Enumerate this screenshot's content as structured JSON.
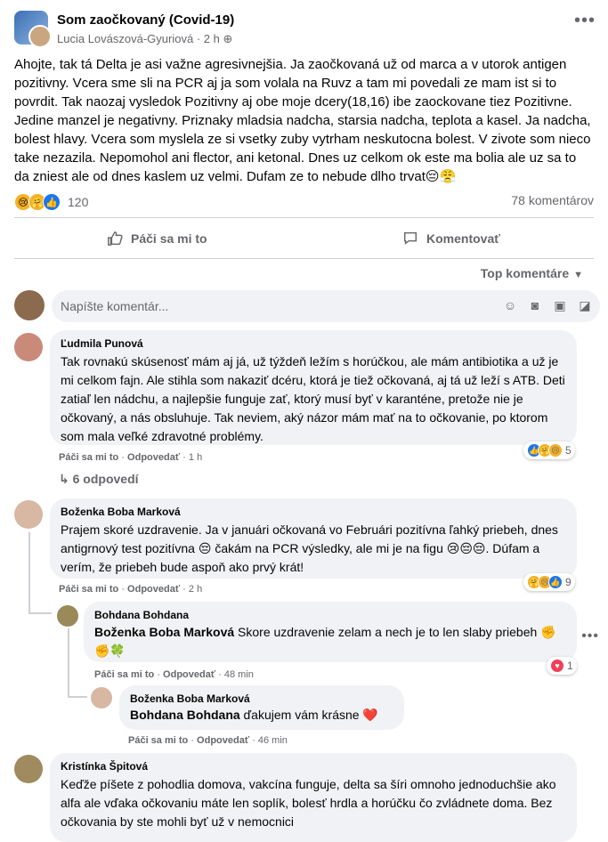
{
  "post": {
    "group": "Som zaočkovaný (Covid-19)",
    "author": "Lucia Lovászová-Gyuriová",
    "time": "2 h",
    "body": "Ahojte, tak tá Delta je asi važne agresivnejšia. Ja zaočkovaná už od marca a v utorok antigen pozitivny. Vcera sme sli na PCR aj ja som volala na Ruvz a tam mi povedali ze mam ist si to povrdit. Tak naozaj vysledok Pozitivny aj obe moje dcery(18,16) ibe zaockovane tiez Pozitivne. Jedine manzel je negativny. Priznaky mladsia nadcha, starsia nadcha, teplota a kasel. Ja nadcha, bolest hlavy. Vcera som myslela ze si vsetky zuby vytrham  neskutocna bolest. V zivote som nieco take nezazila. Nepomohol ani flector, ani ketonal. Dnes uz celkom ok este ma bolia ale uz sa to da zniest ale od dnes kaslem uz velmi. Dufam ze to nebude dlho trvat😔😤",
    "reaction_count": "120",
    "comment_count": "78 komentárov"
  },
  "actions": {
    "like": "Páči sa mi to",
    "comment": "Komentovať"
  },
  "sort_label": "Top komentáre",
  "composer": {
    "placeholder": "Napíšte komentár..."
  },
  "comments": [
    {
      "name": "Ľudmila Punová",
      "text": "Tak rovnakú skúsenosť mám aj já, už týždeň ležím s horúčkou, ale mám antibiotika a už je mi celkom fajn. Ale stihla som nakaziť dcéru, ktorá je tiež očkovaná, aj tá už leží s ATB. Deti zatiaľ len nádchu, a najlepšie funguje zať, ktorý musí byť v karanténe, pretože nie je očkovaný, a nás obsluhuje. Tak neviem, aký názor mám mať na to očkovanie, po ktorom som mala veľké zdravotné problémy.",
      "like": "Páči sa mi to",
      "reply": "Odpovedať",
      "time": "1 h",
      "reactions": "5",
      "replies_label": "6 odpovedí"
    },
    {
      "name": "Boženka Boba Marková",
      "text": "Prajem skoré uzdravenie. Ja v januári očkovaná vo Februári pozitívna ľahký priebeh, dnes antigrnový test pozitívna 😔 čakám na PCR výsledky, ale mi je na figu 😢😔😔. Dúfam a verím, že priebeh bude aspoň ako prvý krát!",
      "like": "Páči sa mi to",
      "reply": "Odpovedať",
      "time": "2 h",
      "reactions": "9"
    },
    {
      "name": "Bohdana Bohdana",
      "mention": "Boženka Boba Marková",
      "text": " Skore uzdravenie zelam a nech je to len slaby priebeh ✊✊🍀",
      "like": "Páči sa mi to",
      "reply": "Odpovedať",
      "time": "48 min",
      "reactions": "1"
    },
    {
      "name": "Boženka Boba Marková",
      "mention": "Bohdana Bohdana",
      "text": " ďakujem vám krásne ❤️",
      "like": "Páči sa mi to",
      "reply": "Odpovedať",
      "time": "46 min"
    },
    {
      "name": "Kristínka Špitová",
      "text": "Keďže píšete z pohodlia domova, vakcína funguje, delta sa šíri omnoho jednoduchšie ako alfa ale vďaka očkovaniu máte len soplík, bolesť hrdla a horúčku čo zvládnete doma. Bez očkovania by ste mohli byť už v nemocnici"
    }
  ],
  "colors": {
    "like_blue": "#1877f2",
    "muted": "#65676b",
    "bubble": "#f0f2f5"
  }
}
